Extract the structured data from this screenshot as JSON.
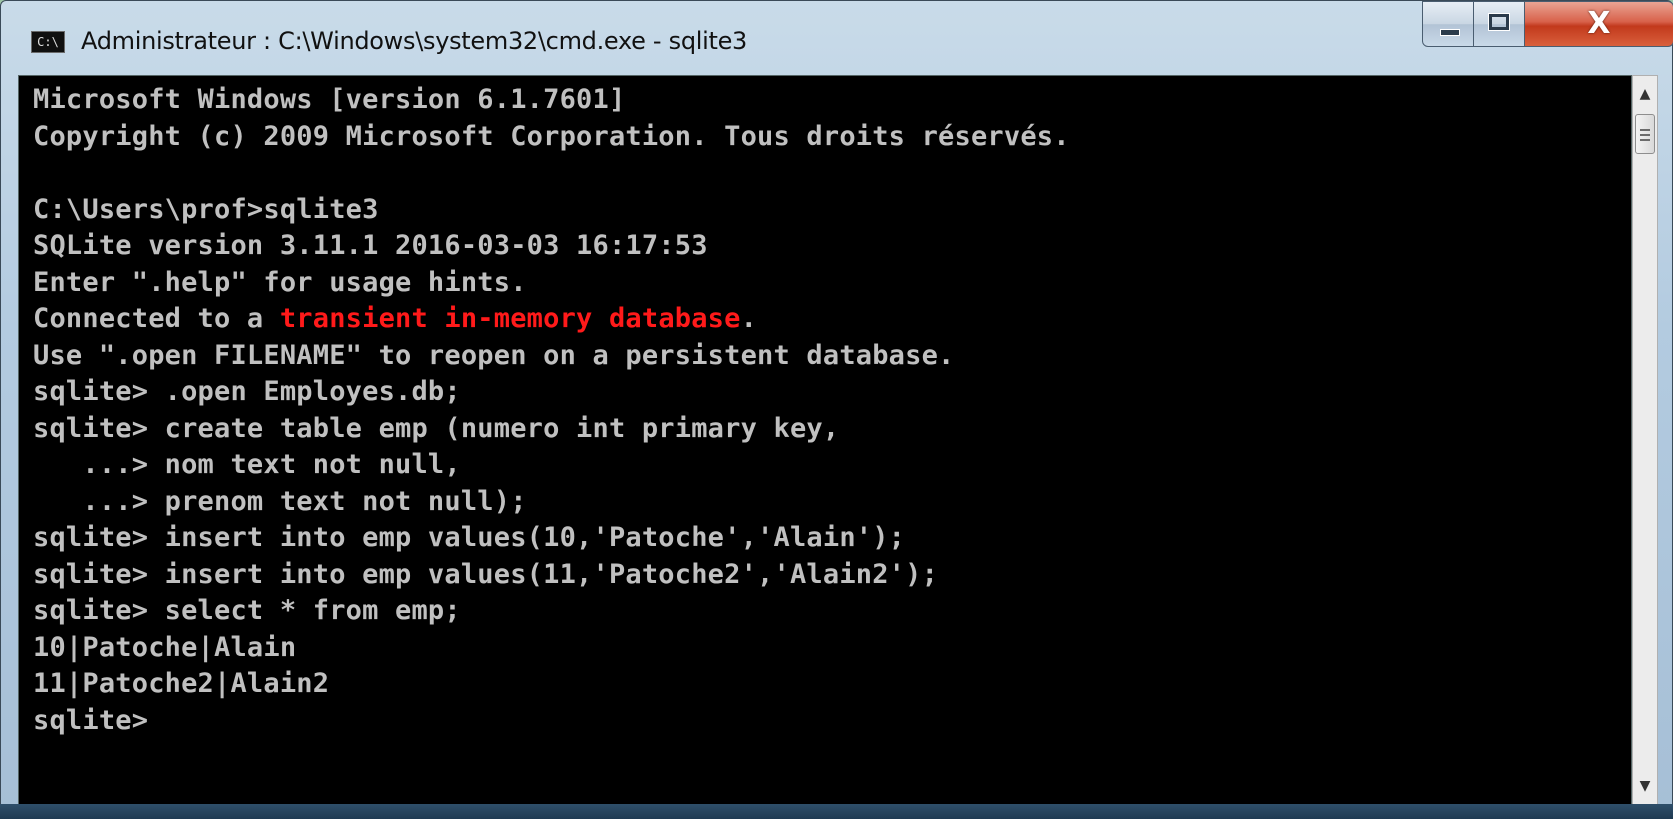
{
  "window": {
    "title": "Administrateur : C:\\Windows\\system32\\cmd.exe - sqlite3",
    "icon": "console-window-icon",
    "icon_text": "C:\\",
    "controls": {
      "minimize_icon": "minimize-icon",
      "maximize_icon": "maximize-icon",
      "close_icon": "close-icon",
      "close_label": "X"
    }
  },
  "console": {
    "line0": "Microsoft Windows [version 6.1.7601]",
    "line1": "Copyright (c) 2009 Microsoft Corporation. Tous droits réservés.",
    "line2": "",
    "line3": "C:\\Users\\prof>sqlite3",
    "line4": "SQLite version 3.11.1 2016-03-03 16:17:53",
    "line5": "Enter \".help\" for usage hints.",
    "line6_a": "Connected to a ",
    "line6_b": "transient in-memory database",
    "line6_c": ".",
    "line7": "Use \".open FILENAME\" to reopen on a persistent database.",
    "line8": "sqlite> .open Employes.db;",
    "line9": "sqlite> create table emp (numero int primary key,",
    "line10": "   ...> nom text not null,",
    "line11": "   ...> prenom text not null);",
    "line12": "sqlite> insert into emp values(10,'Patoche','Alain');",
    "line13": "sqlite> insert into emp values(11,'Patoche2','Alain2');",
    "line14": "sqlite> select * from emp;",
    "line15": "10|Patoche|Alain",
    "line16": "11|Patoche2|Alain2",
    "line17": "sqlite>",
    "text_color": "#c0c0c0",
    "highlight_color": "#ff1a1a",
    "background": "#000000"
  },
  "scrollbar": {
    "up_arrow": "▲",
    "down_arrow": "▼",
    "up_icon": "scroll-up-arrow-icon",
    "down_icon": "scroll-down-arrow-icon"
  }
}
